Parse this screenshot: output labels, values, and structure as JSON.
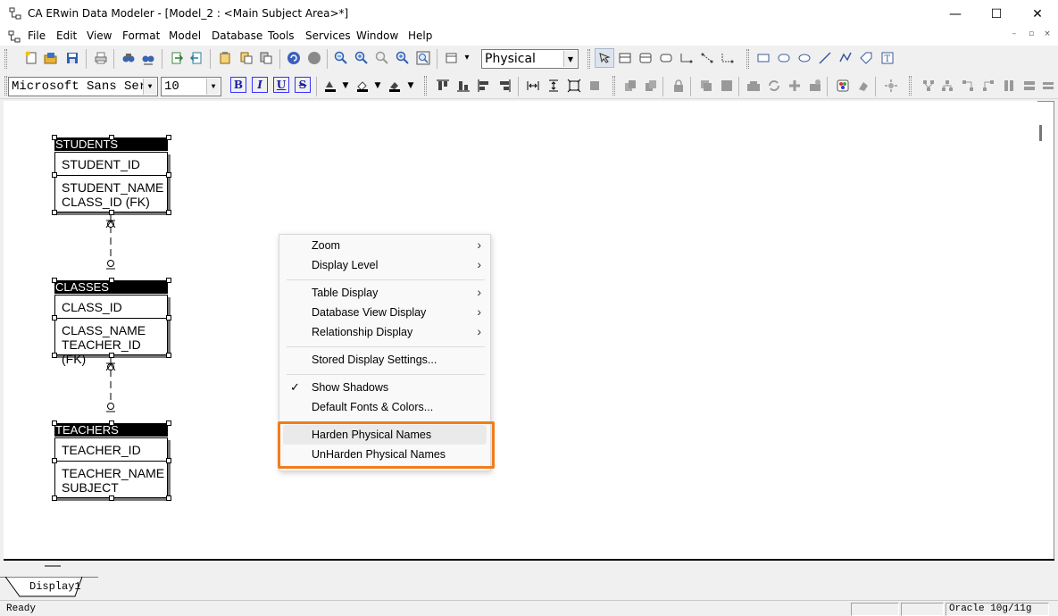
{
  "window": {
    "title": "CA ERwin Data Modeler - [Model_2 : <Main Subject Area>*]",
    "controls": [
      "—",
      "☐",
      "✕"
    ]
  },
  "menubar": {
    "items": [
      "File",
      "Edit",
      "View",
      "Format",
      "Model",
      "Database",
      "Tools",
      "Services",
      "Window",
      "Help"
    ],
    "mdi_controls": [
      "–",
      "▫",
      "×"
    ]
  },
  "toolbar1": {
    "display_level_select": "Physical"
  },
  "toolbar2": {
    "font_select": "Microsoft Sans Ser:",
    "size_select": "10",
    "bold": "B",
    "italic": "I",
    "underline": "U",
    "strike": "S"
  },
  "entities": [
    {
      "name": "STUDENTS",
      "key": "STUDENT_ID",
      "attributes": [
        "STUDENT_NAME",
        "CLASS_ID (FK)"
      ]
    },
    {
      "name": "CLASSES",
      "key": "CLASS_ID",
      "attributes": [
        "CLASS_NAME",
        "TEACHER_ID (FK)"
      ]
    },
    {
      "name": "TEACHERS",
      "key": "TEACHER_ID",
      "attributes": [
        "TEACHER_NAME",
        "SUBJECT"
      ]
    }
  ],
  "context_menu": {
    "items": [
      {
        "label": "Zoom",
        "submenu": true
      },
      {
        "label": "Display Level",
        "submenu": true
      },
      {
        "label": "Table Display",
        "submenu": true
      },
      {
        "label": "Database View Display",
        "submenu": true
      },
      {
        "label": "Relationship Display",
        "submenu": true
      },
      {
        "label": "Stored Display Settings...",
        "submenu": false
      },
      {
        "label": "Show Shadows",
        "submenu": false,
        "checked": true
      },
      {
        "label": "Default Fonts & Colors...",
        "submenu": false
      },
      {
        "label": "Harden Physical Names",
        "submenu": false,
        "hovered": true
      },
      {
        "label": "UnHarden Physical Names",
        "submenu": false
      }
    ],
    "submenu_arrow": "›",
    "check_mark": "✓",
    "highlight_color": "#f07d1b"
  },
  "tabs": [
    "Display1"
  ],
  "statusbar": {
    "left": "Ready",
    "right": "Oracle 10g/11g"
  }
}
